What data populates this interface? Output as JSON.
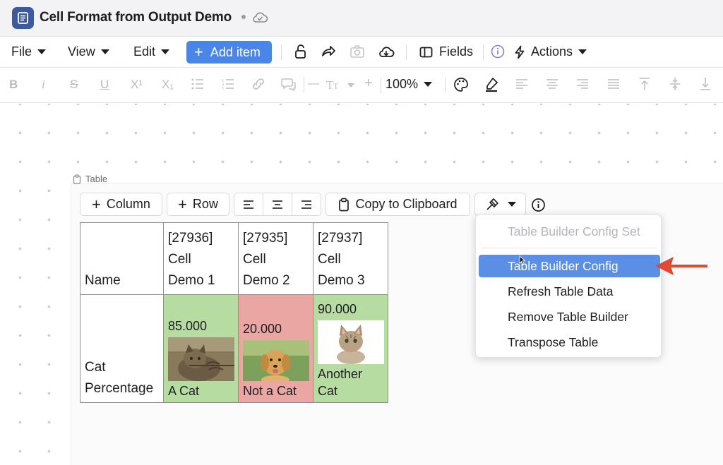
{
  "window": {
    "title": "Cell Format from Output Demo"
  },
  "menubar": {
    "file": "File",
    "view": "View",
    "edit": "Edit",
    "add_item": "Add item",
    "fields": "Fields",
    "actions": "Actions"
  },
  "format_toolbar": {
    "bold": "B",
    "italic": "i",
    "strike": "S",
    "underline": "U",
    "superscript": "X¹",
    "subscript": "X₁",
    "font_size_minus": "—",
    "font_size_plus": "+",
    "zoom": "100%"
  },
  "table_block": {
    "label": "Table",
    "toolbar": {
      "add_column": "Column",
      "add_row": "Row",
      "copy": "Copy to Clipboard"
    }
  },
  "table": {
    "header": [
      "Name",
      "[27936]\nCell\nDemo 1",
      "[27935]\nCell\nDemo 2",
      "[27937]\nCell\nDemo 3"
    ],
    "row_label": "Cat\nPercentage",
    "cells": [
      {
        "value": "85.000",
        "caption": "A Cat",
        "status": "green",
        "image": "tabby-cat"
      },
      {
        "value": "20.000",
        "caption": "Not a Cat",
        "status": "red",
        "image": "golden-retriever"
      },
      {
        "value": "90.000",
        "caption": "Another\nCat",
        "status": "green",
        "image": "kitten"
      }
    ]
  },
  "dropdown": {
    "items": [
      {
        "label": "Table Builder Config Set",
        "enabled": false
      },
      {
        "label": "Table Builder Config",
        "highlighted": true
      },
      {
        "label": "Refresh Table Data"
      },
      {
        "label": "Remove Table Builder"
      },
      {
        "label": "Transpose Table"
      }
    ]
  },
  "colors": {
    "accent": "#4a85e8",
    "highlight": "#5b8fe6",
    "green_cell": "#b7dca2",
    "red_cell": "#e9a6a2",
    "annotation_arrow": "#e04a2f"
  }
}
